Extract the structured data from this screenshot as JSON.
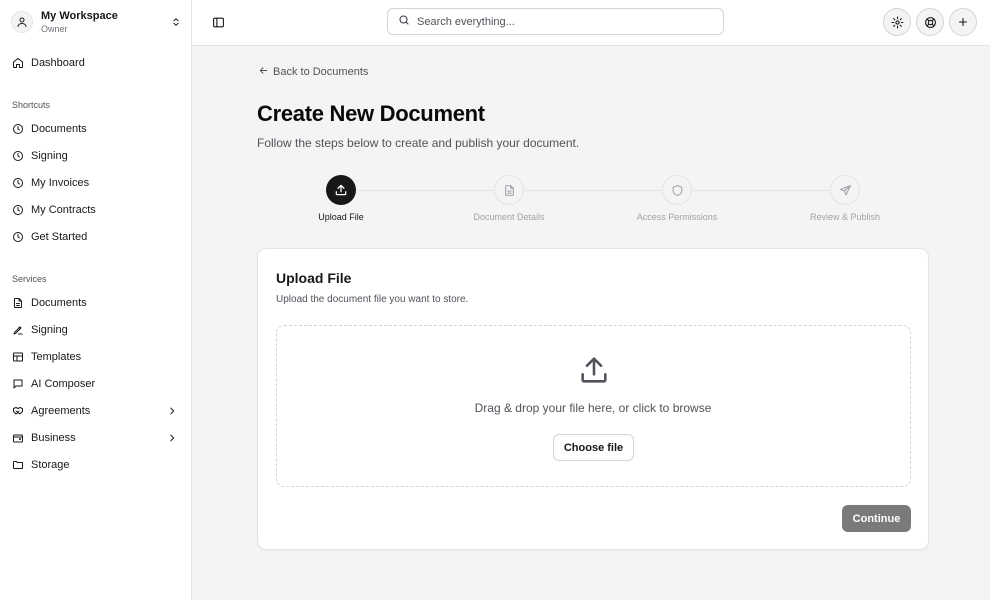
{
  "workspace": {
    "name": "My Workspace",
    "role": "Owner"
  },
  "sidebar": {
    "dashboard": {
      "label": "Dashboard",
      "icon": "home-icon"
    },
    "shortcuts_title": "Shortcuts",
    "shortcuts": [
      {
        "label": "Documents",
        "icon": "clock-icon"
      },
      {
        "label": "Signing",
        "icon": "clock-icon"
      },
      {
        "label": "My Invoices",
        "icon": "clock-icon"
      },
      {
        "label": "My Contracts",
        "icon": "clock-icon"
      },
      {
        "label": "Get Started",
        "icon": "clock-icon"
      }
    ],
    "services_title": "Services",
    "services": [
      {
        "label": "Documents",
        "icon": "file-text-icon"
      },
      {
        "label": "Signing",
        "icon": "signature-icon"
      },
      {
        "label": "Templates",
        "icon": "layout-icon"
      },
      {
        "label": "AI Composer",
        "icon": "message-icon"
      },
      {
        "label": "Agreements",
        "icon": "handshake-icon",
        "expandable": true
      },
      {
        "label": "Business",
        "icon": "wallet-icon",
        "expandable": true
      },
      {
        "label": "Storage",
        "icon": "folder-icon"
      }
    ]
  },
  "topbar": {
    "search": {
      "placeholder": "Search everything...",
      "value": ""
    },
    "buttons": [
      "gear-icon",
      "support-icon",
      "plus-icon"
    ]
  },
  "main": {
    "back_link": "Back to Documents",
    "title": "Create New Document",
    "subtitle": "Follow the steps below to create and publish your document.",
    "steps": [
      {
        "label": "Upload File",
        "icon": "upload-icon",
        "active": true
      },
      {
        "label": "Document Details",
        "icon": "file-text-icon",
        "active": false
      },
      {
        "label": "Access Permissions",
        "icon": "shield-icon",
        "active": false
      },
      {
        "label": "Review & Publish",
        "icon": "send-icon",
        "active": false
      }
    ]
  },
  "card": {
    "title": "Upload File",
    "description": "Upload the document file you want to store.",
    "dropzone_text": "Drag & drop your file here, or click to browse",
    "choose_file_label": "Choose file",
    "continue_label": "Continue"
  },
  "colors": {
    "accent": "#18181b",
    "border": "#e4e4e7",
    "muted_text": "#52525b",
    "disabled_button": "#7a7a7a"
  }
}
